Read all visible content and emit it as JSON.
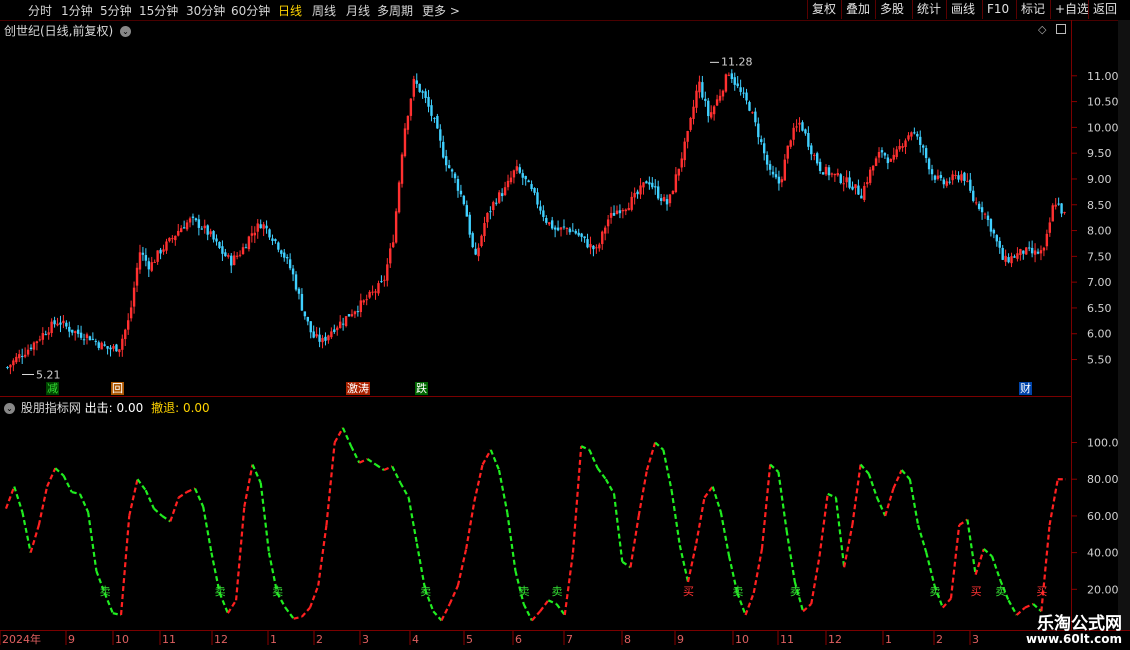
{
  "toolbar": {
    "periods": [
      "分时",
      "1分钟",
      "5分钟",
      "15分钟",
      "30分钟",
      "60分钟",
      "日线",
      "周线",
      "月线",
      "多周期",
      "更多 >"
    ],
    "active_period": "日线",
    "tools": [
      "复权",
      "叠加",
      "多股",
      "统计",
      "画线",
      "F10",
      "标记",
      "+自选",
      "返回"
    ]
  },
  "main_panel": {
    "title": "创世纪(日线,前复权)",
    "high_marker": "11.28",
    "low_marker": "5.21",
    "events": [
      {
        "label": "减",
        "color": "#33dd33",
        "bg": "#004400"
      },
      {
        "label": "回",
        "color": "#ffffff",
        "bg": "#aa5500"
      },
      {
        "label": "激涛",
        "color": "#ffffff",
        "bg": "#aa2200"
      },
      {
        "label": "跌",
        "color": "#ffffff",
        "bg": "#006600"
      },
      {
        "label": "财",
        "color": "#ffffff",
        "bg": "#0044aa"
      }
    ]
  },
  "indicator_panel": {
    "name": "股朋指标网",
    "out_label": "出击:",
    "out_value": "0.00",
    "retreat_label": "撤退:",
    "retreat_value": "0.00",
    "buy_label": "买",
    "sell_label": "卖"
  },
  "x_axis": {
    "labels": [
      "2024年",
      "9",
      "10",
      "11",
      "12",
      "1",
      "2",
      "3",
      "4",
      "5",
      "6",
      "7",
      "8",
      "9",
      "10",
      "11",
      "12",
      "1",
      "2",
      "3"
    ]
  },
  "watermark": {
    "title": "乐淘公式网",
    "url": "www.60lt.com"
  },
  "colors": {
    "up": "#ff3030",
    "down": "#40d0ff",
    "osc_up": "#ff2020",
    "osc_down": "#20ee20",
    "axis": "#8a0000",
    "active": "#ffd400"
  },
  "chart_data": [
    {
      "type": "candlestick",
      "title": "创世纪(日线,前复权)",
      "ylim": [
        5.2,
        11.5
      ],
      "y_ticks": [
        5.5,
        6.0,
        6.5,
        7.0,
        7.5,
        8.0,
        8.5,
        9.0,
        9.5,
        10.0,
        10.5,
        11.0
      ],
      "x_labels": [
        "2024年",
        "9",
        "10",
        "11",
        "12",
        "1",
        "2",
        "3",
        "4",
        "5",
        "6",
        "7",
        "8",
        "9",
        "10",
        "11",
        "12",
        "1",
        "2",
        "3"
      ],
      "close_path": [
        5.35,
        5.55,
        5.7,
        5.9,
        6.1,
        6.25,
        6.1,
        6.0,
        5.95,
        5.8,
        5.7,
        5.75,
        6.3,
        7.6,
        7.3,
        7.6,
        7.8,
        8.05,
        8.2,
        8.1,
        7.9,
        7.6,
        7.4,
        7.6,
        7.95,
        8.15,
        7.9,
        7.6,
        7.2,
        6.5,
        5.95,
        5.85,
        6.1,
        6.25,
        6.45,
        6.6,
        6.8,
        7.0,
        7.9,
        9.9,
        10.9,
        10.6,
        10.1,
        9.4,
        9.0,
        8.5,
        7.4,
        8.2,
        8.6,
        8.8,
        9.2,
        8.95,
        8.6,
        8.2,
        8.0,
        8.05,
        7.95,
        7.75,
        7.6,
        8.2,
        8.4,
        8.5,
        8.7,
        9.0,
        8.7,
        8.5,
        9.2,
        9.9,
        10.9,
        10.2,
        10.6,
        11.1,
        10.7,
        10.4,
        9.8,
        9.1,
        8.9,
        9.8,
        10.1,
        9.6,
        9.2,
        9.1,
        9.0,
        8.9,
        8.7,
        9.2,
        9.55,
        9.3,
        9.7,
        9.95,
        9.6,
        9.1,
        8.9,
        9.0,
        9.1,
        8.6,
        8.4,
        7.95,
        7.4,
        7.5,
        7.6,
        7.55,
        7.6,
        8.6,
        8.3
      ],
      "high": 11.28,
      "low": 5.21
    },
    {
      "type": "line",
      "series": [
        {
          "name": "股朋指标网"
        }
      ],
      "ylim": [
        0,
        115
      ],
      "y_ticks": [
        20,
        40,
        60,
        80,
        100
      ],
      "values": [
        64,
        76,
        62,
        40,
        55,
        76,
        86,
        82,
        73,
        72,
        62,
        30,
        18,
        7,
        6,
        60,
        80,
        74,
        64,
        60,
        57,
        70,
        73,
        75,
        65,
        40,
        18,
        7,
        14,
        65,
        88,
        78,
        40,
        18,
        10,
        4,
        5,
        10,
        22,
        55,
        100,
        108,
        98,
        89,
        91,
        88,
        85,
        87,
        78,
        70,
        45,
        20,
        8,
        3,
        12,
        22,
        42,
        68,
        88,
        96,
        85,
        62,
        30,
        12,
        3,
        8,
        14,
        12,
        6,
        40,
        98,
        96,
        86,
        80,
        72,
        35,
        32,
        60,
        85,
        100,
        96,
        74,
        44,
        24,
        45,
        70,
        76,
        62,
        38,
        18,
        6,
        18,
        42,
        88,
        84,
        52,
        24,
        8,
        12,
        38,
        72,
        70,
        32,
        55,
        88,
        83,
        70,
        60,
        75,
        85,
        80,
        55,
        40,
        22,
        10,
        15,
        55,
        58,
        28,
        42,
        38,
        25,
        14,
        6,
        10,
        12,
        8,
        55,
        80,
        80
      ]
    }
  ]
}
